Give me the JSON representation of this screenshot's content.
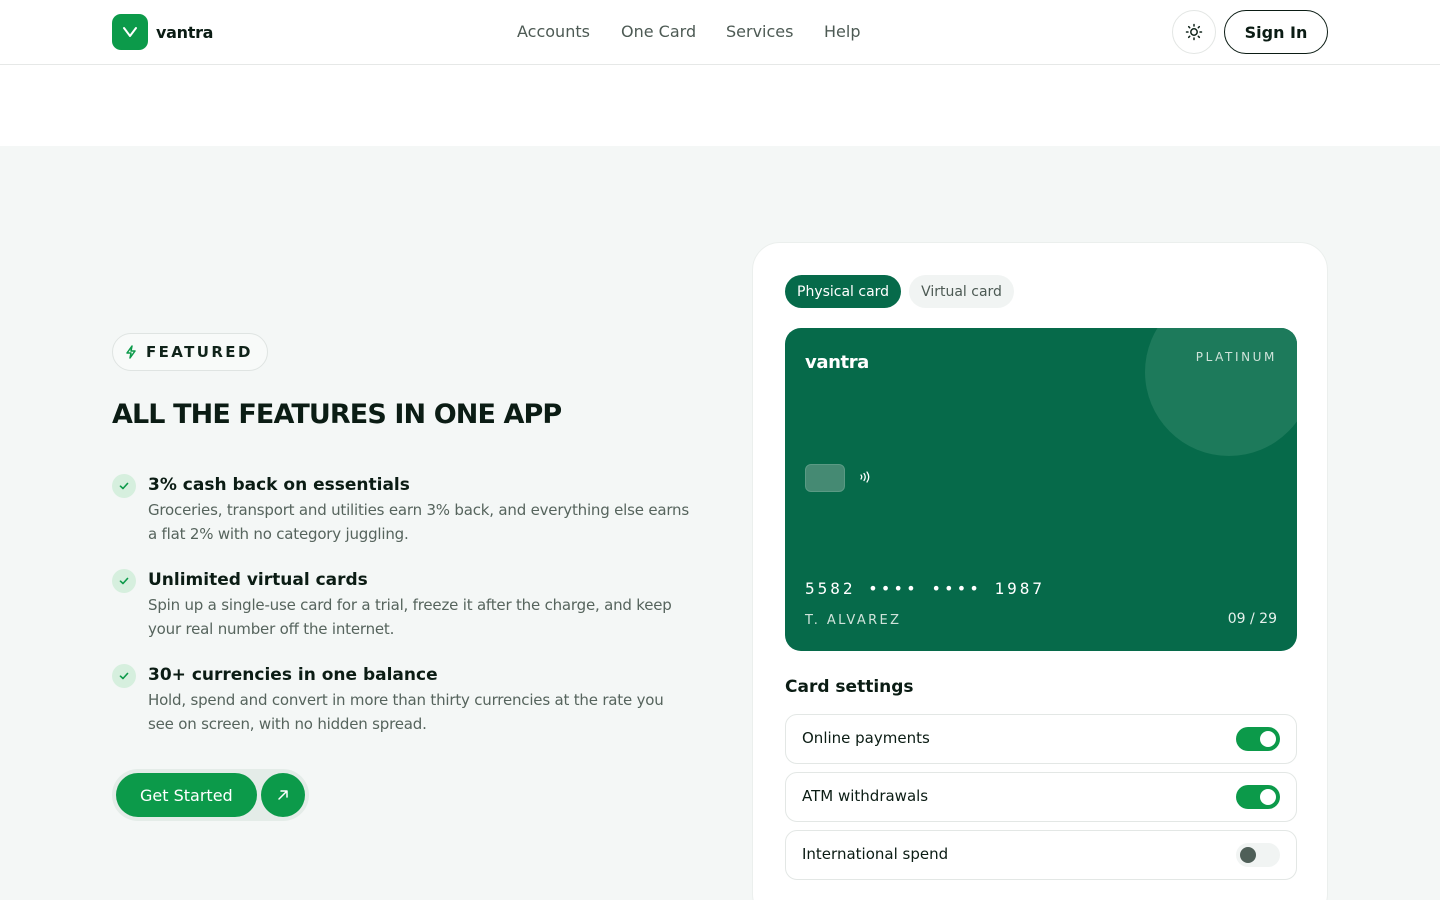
{
  "brand": {
    "name": "vantra",
    "accent": "#0c9a4a",
    "card_color": "#066a4a"
  },
  "nav": {
    "items": [
      "Accounts",
      "One Card",
      "Services",
      "Help"
    ]
  },
  "header": {
    "theme_icon": "sun-icon",
    "signin_label": "Sign In"
  },
  "featured": {
    "badge": "FEATURED",
    "badge_icon": "bolt-icon",
    "headline": "ALL THE FEATURES IN ONE APP",
    "features": [
      {
        "title": "3% cash back on essentials",
        "description": "Groceries, transport and utilities earn 3% back, and everything else earns a flat 2% with no category juggling."
      },
      {
        "title": "Unlimited virtual cards",
        "description": "Spin up a single-use card for a trial, freeze it after the charge, and keep your real number off the internet."
      },
      {
        "title": "30+ currencies in one balance",
        "description": "Hold, spend and convert in more than thirty currencies at the rate you see on screen, with no hidden spread."
      }
    ],
    "cta_label": "Get Started",
    "cta_icon": "arrow-up-right-icon"
  },
  "card_panel": {
    "tabs": [
      {
        "label": "Physical card",
        "active": true
      },
      {
        "label": "Virtual card",
        "active": false
      }
    ],
    "card": {
      "brand": "vantra",
      "tier": "PLATINUM",
      "number": "5582 •••• •••• 1987",
      "holder": "T. ALVAREZ",
      "expiry": "09 / 29"
    },
    "settings_title": "Card settings",
    "settings": [
      {
        "label": "Online payments",
        "enabled": true
      },
      {
        "label": "ATM withdrawals",
        "enabled": true
      },
      {
        "label": "International spend",
        "enabled": false
      }
    ]
  }
}
